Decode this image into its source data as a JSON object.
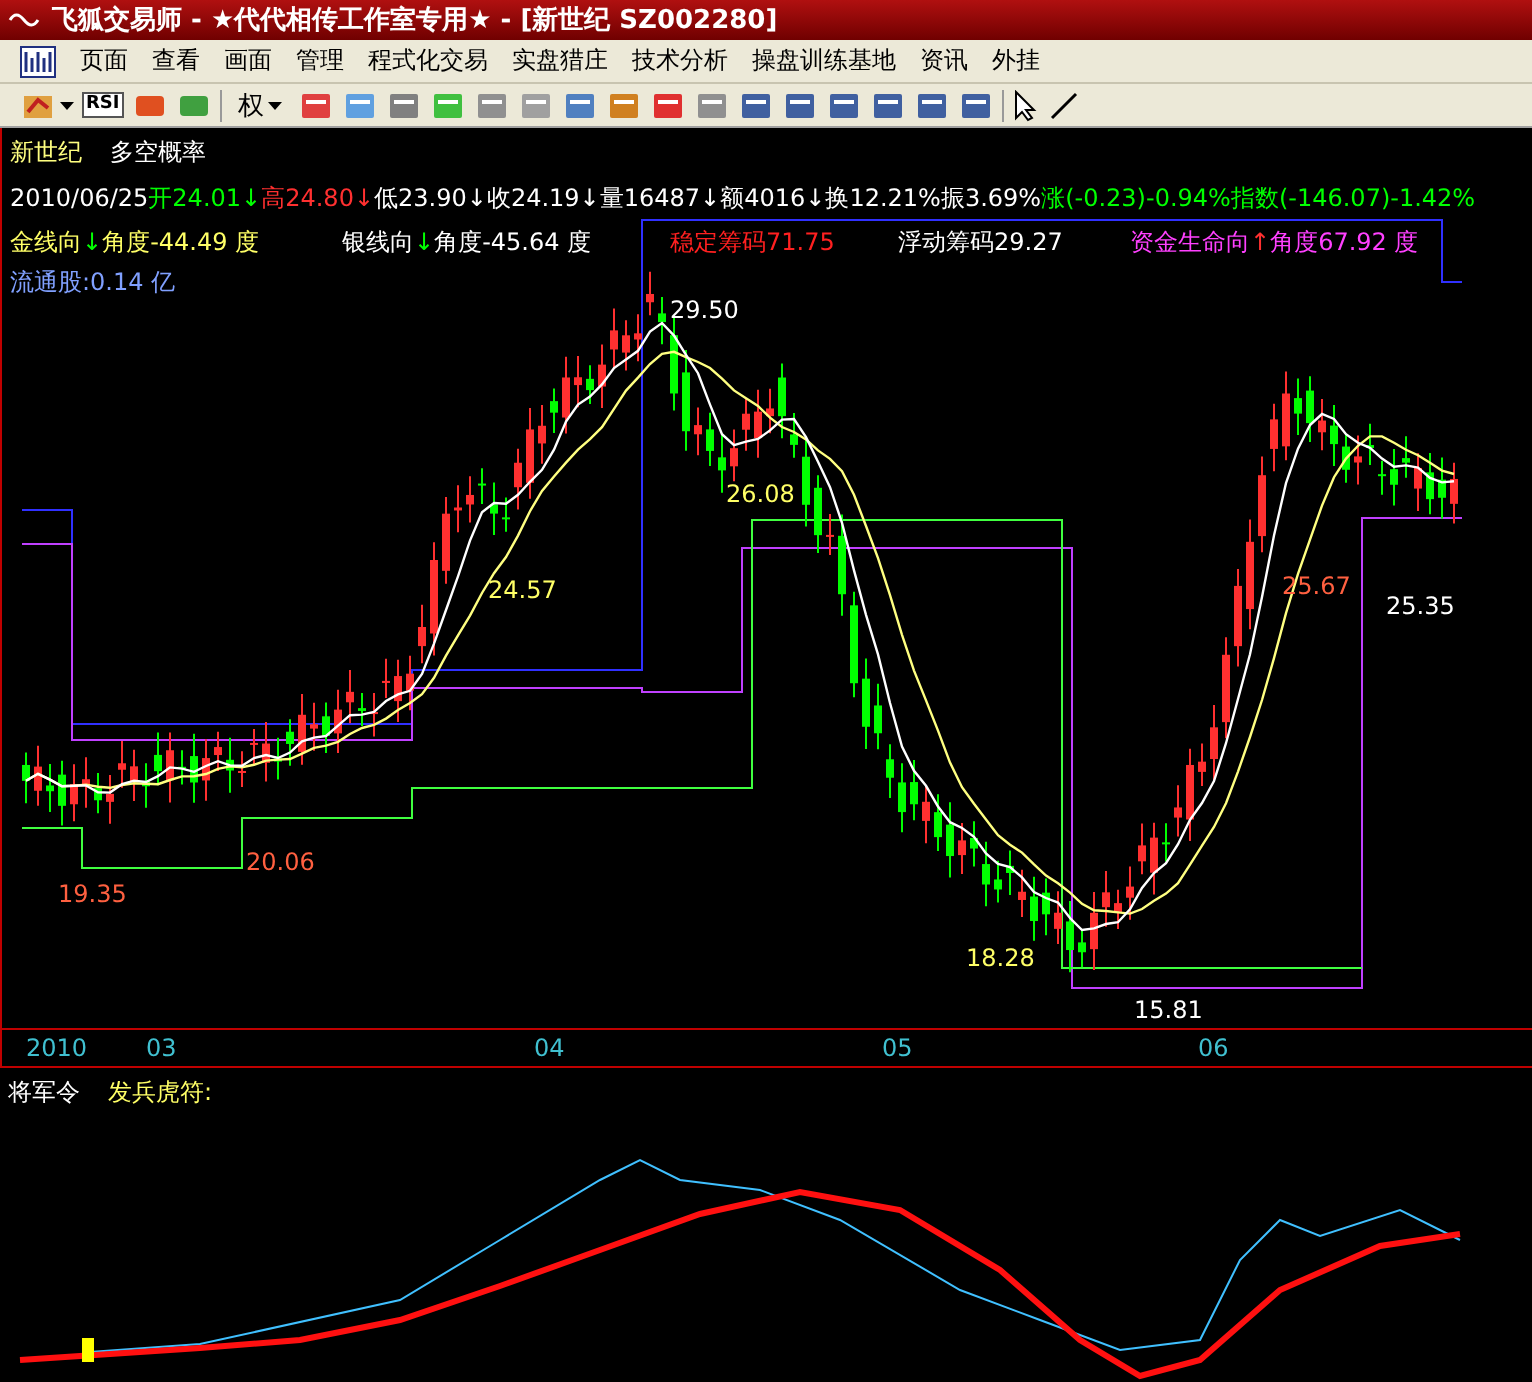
{
  "window": {
    "title": "飞狐交易师 - ★代代相传工作室专用★ - [新世纪  SZ002280]"
  },
  "menu": [
    "页面",
    "查看",
    "画面",
    "管理",
    "程式化交易",
    "实盘猎庄",
    "技术分析",
    "操盘训练基地",
    "资讯",
    "外挂"
  ],
  "toolbar": {
    "rsi_label": "RSI",
    "rights_label": "权"
  },
  "chart_header": {
    "stock_name": "新世纪",
    "indicator_name": "多空概率"
  },
  "quote_line": [
    {
      "text": "2010/06/25",
      "color": "#ffffff"
    },
    {
      "text": "开24.01↓",
      "color": "#00ff00"
    },
    {
      "text": "高24.80↓",
      "color": "#ff3030"
    },
    {
      "text": "低23.90↓",
      "color": "#ffffff"
    },
    {
      "text": "收24.19↓",
      "color": "#ffffff"
    },
    {
      "text": "量16487↓",
      "color": "#ffffff"
    },
    {
      "text": "额4016↓",
      "color": "#ffffff"
    },
    {
      "text": "换12.21%",
      "color": "#ffffff"
    },
    {
      "text": "振3.69%",
      "color": "#ffffff"
    },
    {
      "text": "涨(-0.23)-0.94%",
      "color": "#00ff00"
    },
    {
      "text": "指数(-146.07)-1.42%",
      "color": "#00ff00"
    }
  ],
  "indicator_values": [
    {
      "parts": [
        {
          "text": "金线向",
          "color": "#ffff66"
        },
        {
          "text": "↓",
          "color": "#00ff00"
        },
        {
          "text": "角度-44.49 度",
          "color": "#ffff66"
        }
      ]
    },
    {
      "parts": [
        {
          "text": "银线向",
          "color": "#ffffff"
        },
        {
          "text": "↓",
          "color": "#00ff00"
        },
        {
          "text": "角度-45.64 度",
          "color": "#ffffff"
        }
      ]
    },
    {
      "parts": [
        {
          "text": "稳定筹码71.75",
          "color": "#ff2020"
        }
      ]
    },
    {
      "parts": [
        {
          "text": "浮动筹码29.27",
          "color": "#ffffff"
        }
      ]
    },
    {
      "parts": [
        {
          "text": "资金生命向",
          "color": "#ff40ff"
        },
        {
          "text": "↑",
          "color": "#ff3030"
        },
        {
          "text": "角度67.92 度",
          "color": "#ff40ff"
        }
      ]
    }
  ],
  "float_shares": "流通股:0.14 亿",
  "price_labels": [
    {
      "text": "29.50",
      "color": "#ffffff"
    },
    {
      "text": "26.08",
      "color": "#ffff66"
    },
    {
      "text": "24.57",
      "color": "#ffff66"
    },
    {
      "text": "19.35",
      "color": "#ff6040"
    },
    {
      "text": "20.06",
      "color": "#ff6040"
    },
    {
      "text": "18.28",
      "color": "#ffff66"
    },
    {
      "text": "15.81",
      "color": "#ffffff"
    },
    {
      "text": "25.67",
      "color": "#ff6040"
    },
    {
      "text": "25.35",
      "color": "#ffffff"
    }
  ],
  "x_axis": [
    "2010",
    "03",
    "04",
    "05",
    "06"
  ],
  "sub_panel": {
    "title": "将军令",
    "indicator": "发兵虎符:"
  }
}
